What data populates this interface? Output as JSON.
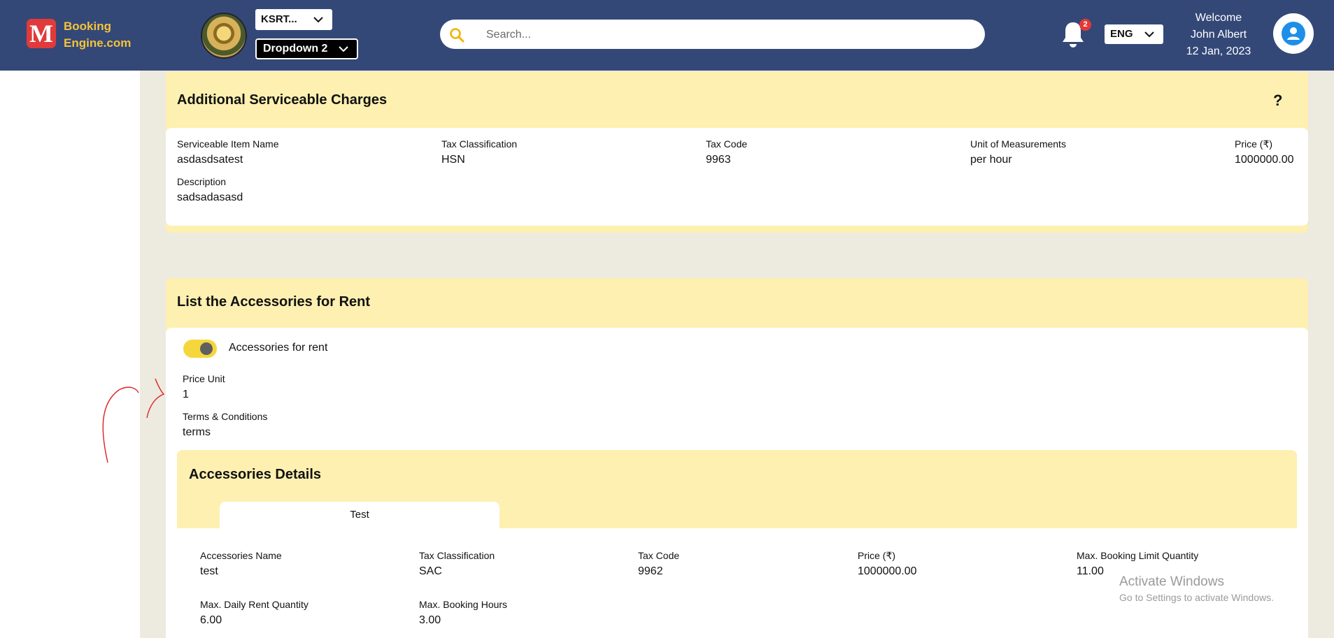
{
  "header": {
    "logo_letter": "M",
    "brand_line1": "Booking",
    "brand_line2": "Engine.com",
    "org_dropdown": "KSRT...",
    "dropdown2": "Dropdown 2",
    "search_placeholder": "Search...",
    "notification_count": "2",
    "language": "ENG",
    "welcome": "Welcome",
    "user_name": "John Albert",
    "date": "12 Jan, 2023"
  },
  "charges": {
    "title": "Additional Serviceable Charges",
    "help": "?",
    "fields": [
      {
        "label": "Serviceable Item Name",
        "value": "asdasdsatest"
      },
      {
        "label": "Tax Classification",
        "value": "HSN"
      },
      {
        "label": "Tax Code",
        "value": "9963"
      },
      {
        "label": "Unit of Measurements",
        "value": "per hour"
      },
      {
        "label": "Price (₹)",
        "value": "1000000.00"
      },
      {
        "label": "Description",
        "value": "sadsadasasd"
      }
    ]
  },
  "accessories": {
    "title": "List the Accessories for Rent",
    "toggle_label": "Accessories for rent",
    "toggle_on": true,
    "fields": [
      {
        "label": "Price Unit",
        "value": "1"
      },
      {
        "label": "Terms & Conditions",
        "value": "terms"
      }
    ],
    "details": {
      "title": "Accessories Details",
      "tab": "Test",
      "fields": [
        {
          "label": "Accessories Name",
          "value": "test"
        },
        {
          "label": "Tax Classification",
          "value": "SAC"
        },
        {
          "label": "Tax Code",
          "value": "9962"
        },
        {
          "label": "Price (₹)",
          "value": "1000000.00"
        },
        {
          "label": "Max. Booking Limit Quantity",
          "value": "11.00"
        },
        {
          "label": "Max. Daily Rent Quantity",
          "value": "6.00"
        },
        {
          "label": "Max. Booking Hours",
          "value": "3.00"
        }
      ]
    }
  },
  "watermark": {
    "line1": "Activate Windows",
    "line2": "Go to Settings to activate Windows."
  },
  "colors": {
    "topbar": "#344878",
    "panel_header": "#fdf0b0",
    "content_bg": "#edeae0",
    "toggle": "#f5d63d",
    "brand_text": "#f4c33a"
  }
}
